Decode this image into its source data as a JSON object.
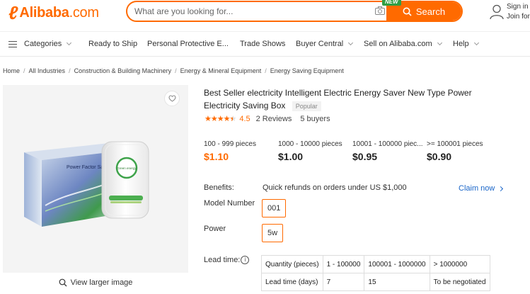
{
  "header": {
    "logo_text": "Alibaba",
    "logo_suffix": ".com",
    "search_placeholder": "What are you looking for...",
    "search_button": "Search",
    "new_badge": "NEW",
    "sign_in": "Sign in",
    "join_free": "Join for free"
  },
  "nav": {
    "categories": "Categories",
    "ready_to_ship": "Ready to Ship",
    "ppe": "Personal Protective E...",
    "trade_shows": "Trade Shows",
    "buyer_central": "Buyer Central",
    "sell": "Sell on Alibaba.com",
    "help": "Help"
  },
  "breadcrumb": [
    "Home",
    "All Industries",
    "Construction & Building Machinery",
    "Energy & Mineral Equipment",
    "Energy Saving Equipment"
  ],
  "product": {
    "title": "Best Seller electricity Intelligent Electric Energy Saver New Type Power Electricity Saving Box",
    "popular_tag": "Popular",
    "rating": "4.5",
    "reviews": "2 Reviews",
    "buyers": "5 buyers",
    "image_box_label": "Power Factor Saver",
    "image_device_label": "Green energy",
    "view_larger": "View larger image"
  },
  "price_tiers": [
    {
      "qty": "100 - 999 pieces",
      "price": "$1.10"
    },
    {
      "qty": "1000 - 10000 pieces",
      "price": "$1.00"
    },
    {
      "qty": "10001 - 100000 piec...",
      "price": "$0.95"
    },
    {
      "qty": ">= 100001 pieces",
      "price": "$0.90"
    }
  ],
  "attributes": {
    "benefits_label": "Benefits:",
    "benefits_text": "Quick refunds on orders under US $1,000",
    "claim_now": "Claim now",
    "model_label": "Model Number",
    "model_value": "001",
    "power_label": "Power",
    "power_value": "5w",
    "lead_label": "Lead time:"
  },
  "lead_table": {
    "row1": [
      "Quantity (pieces)",
      "1 - 100000",
      "100001 - 1000000",
      "> 1000000"
    ],
    "row2": [
      "Lead time (days)",
      "7",
      "15",
      "To be negotiated"
    ]
  },
  "colors": {
    "accent": "#ff6a00",
    "link": "#1a66c9"
  }
}
